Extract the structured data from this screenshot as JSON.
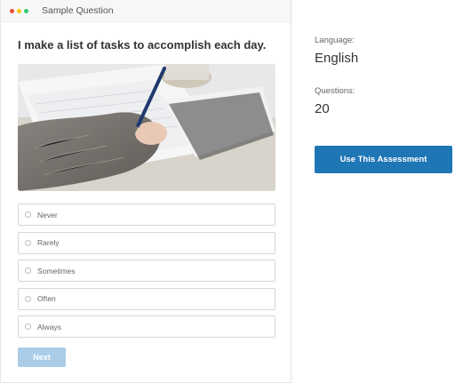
{
  "window": {
    "title": "Sample Question",
    "dot_colors": [
      "#e74c3c",
      "#f1c40f",
      "#2ecc71"
    ]
  },
  "question": {
    "text": "I make a list of tasks to accomplish each day.",
    "image_icon": "photo-person-writing-notes",
    "options": [
      "Never",
      "Rarely",
      "Sometimes",
      "Often",
      "Always"
    ],
    "next_label": "Next"
  },
  "details": {
    "language_label": "Language:",
    "language_value": "English",
    "questions_label": "Questions:",
    "questions_value": "20",
    "use_button_label": "Use This Assessment"
  },
  "colors": {
    "primary": "#1f76b5",
    "next_disabled": "#a9cde9"
  }
}
